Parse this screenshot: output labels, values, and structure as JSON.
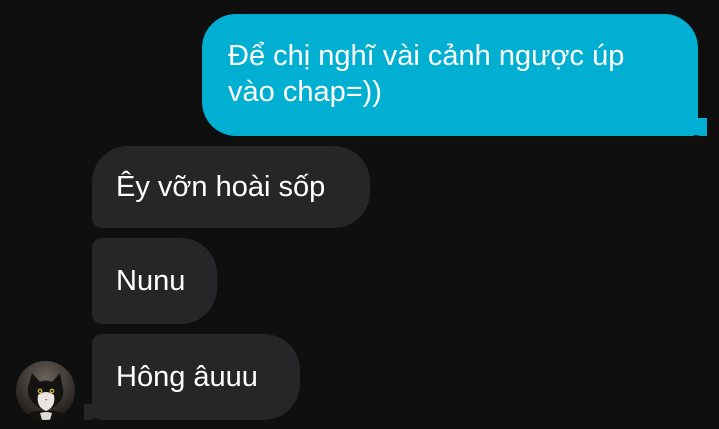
{
  "conversation": {
    "messages": [
      {
        "direction": "outgoing",
        "text": "Để chị nghĩ vài cảnh ngược úp vào chap=))"
      },
      {
        "direction": "incoming",
        "text": "Êy vỡn hoài sốp"
      },
      {
        "direction": "incoming",
        "text": "Nunu"
      },
      {
        "direction": "incoming",
        "text": "Hông âuuu"
      }
    ],
    "sender_avatar_icon": "cat-photo-avatar"
  },
  "colors": {
    "background": "#0f0f10",
    "outgoing_bubble": "#00afd2",
    "incoming_bubble": "#262628",
    "text": "#ffffff"
  }
}
